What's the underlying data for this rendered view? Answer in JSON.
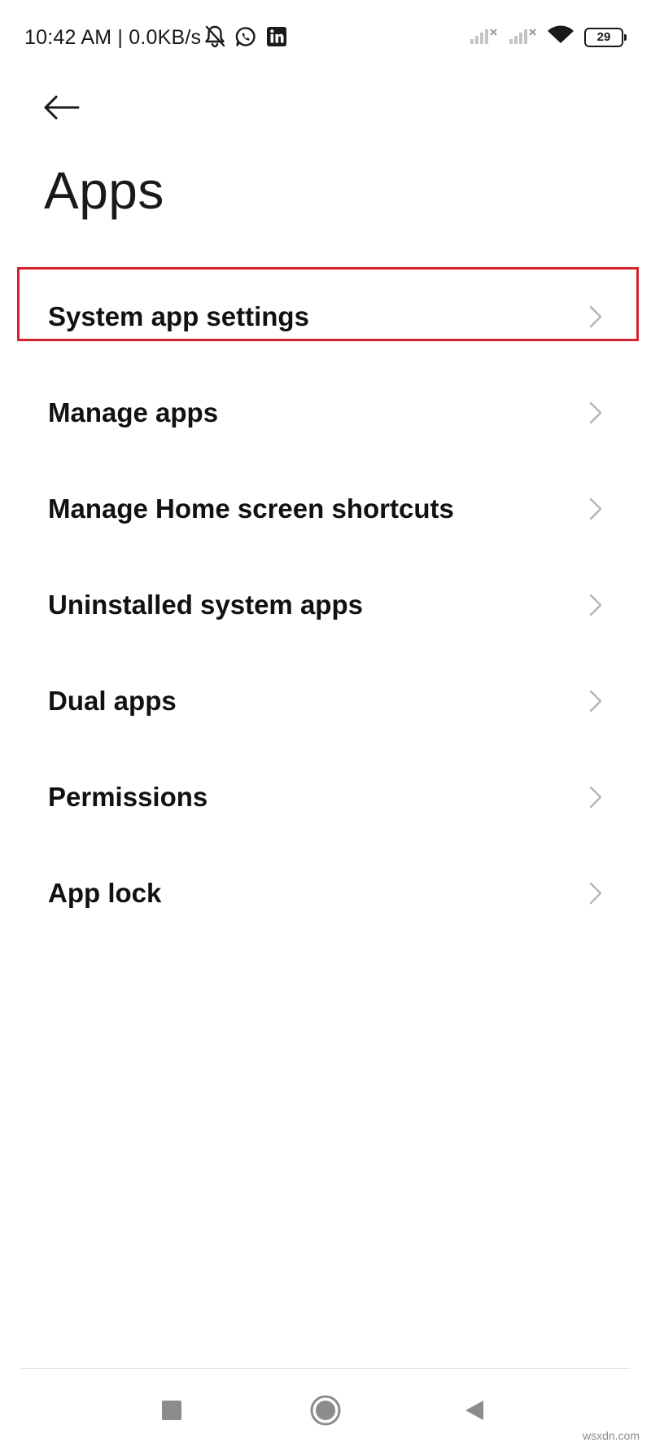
{
  "status_bar": {
    "time_text": "10:42 AM | 0.0KB/s",
    "left_icons": [
      "bell-muted-icon",
      "whatsapp-icon",
      "linkedin-icon"
    ],
    "right_icons": [
      "signal-no-service-icon",
      "signal-no-service-icon",
      "wifi-icon",
      "battery-icon"
    ],
    "battery_level": "29"
  },
  "header": {
    "back_icon": "back-arrow-icon",
    "title": "Apps"
  },
  "menu": {
    "items": [
      {
        "label": "System app settings",
        "highlighted": true
      },
      {
        "label": "Manage apps"
      },
      {
        "label": "Manage Home screen shortcuts"
      },
      {
        "label": "Uninstalled system apps"
      },
      {
        "label": "Dual apps"
      },
      {
        "label": "Permissions"
      },
      {
        "label": "App lock"
      }
    ]
  },
  "nav_bar": {
    "buttons": [
      "recents-square-icon",
      "home-circle-icon",
      "back-triangle-icon"
    ]
  },
  "watermark": "wsxdn.com",
  "colors": {
    "highlight_border": "#d6242d",
    "text": "#111111",
    "chevron": "#b5b5b5",
    "nav_icon": "#8c8c8c"
  }
}
